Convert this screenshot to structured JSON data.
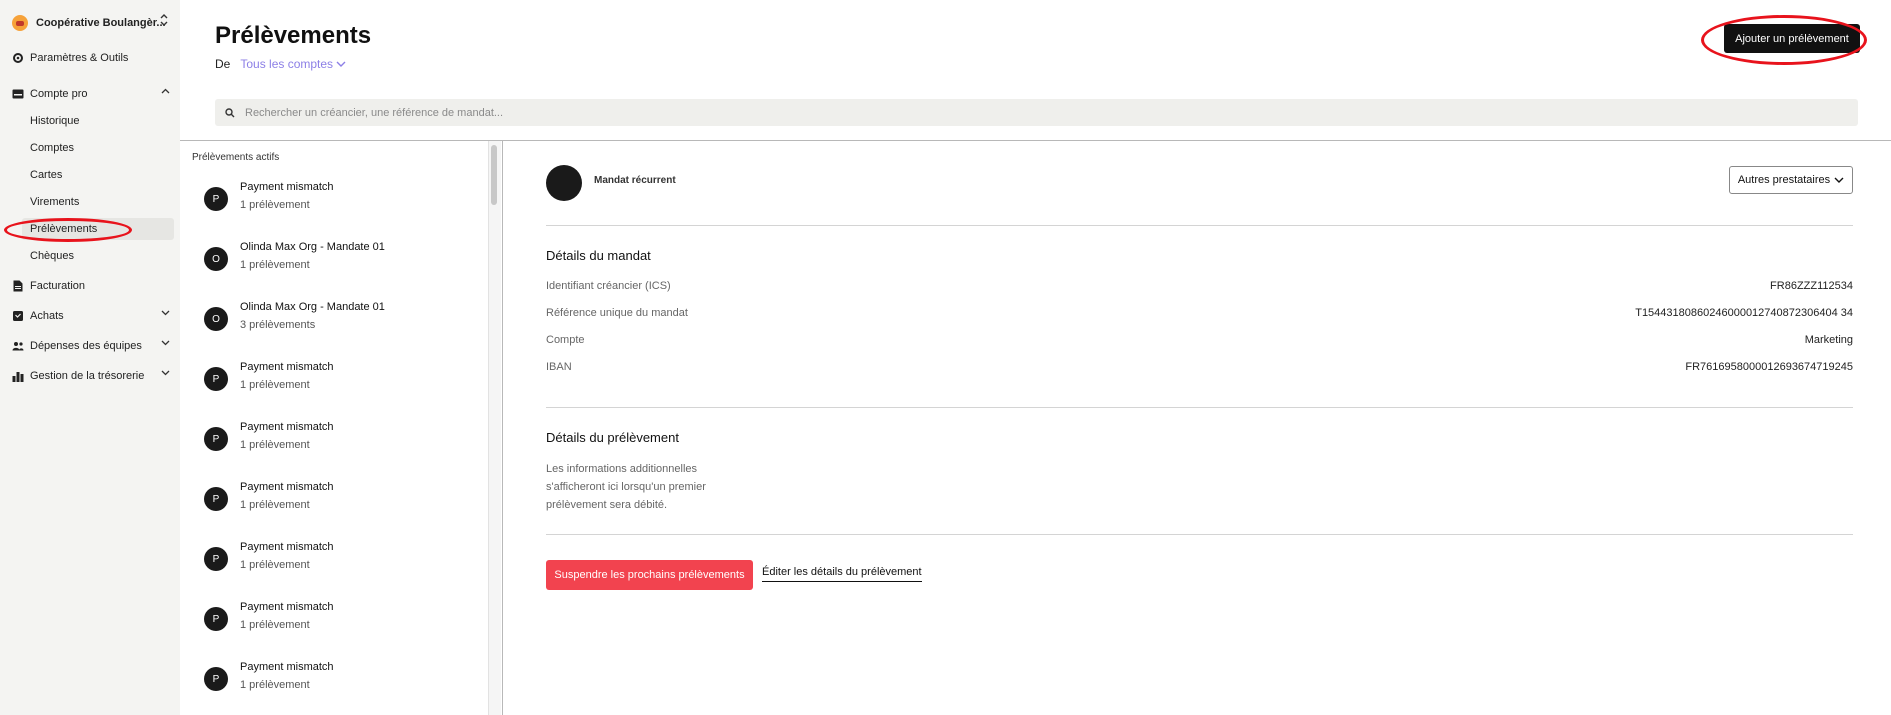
{
  "sidebar": {
    "org_name": "Coopérative Boulangèr...",
    "items": [
      {
        "label": "Paramètres & Outils",
        "icon": "gear-icon"
      },
      {
        "label": "Compte pro",
        "icon": "card-icon"
      },
      {
        "label": "Facturation",
        "icon": "document-icon"
      },
      {
        "label": "Achats",
        "icon": "cart-icon"
      },
      {
        "label": "Dépenses des équipes",
        "icon": "team-icon"
      },
      {
        "label": "Gestion de la trésorerie",
        "icon": "bar-chart-icon"
      }
    ],
    "sub_items": [
      "Historique",
      "Comptes",
      "Cartes",
      "Virements",
      "Prélèvements",
      "Chèques"
    ],
    "active_sub_item": "Prélèvements"
  },
  "header": {
    "title": "Prélèvements",
    "from_label": "De",
    "from_value": "Tous les comptes",
    "add_button": "Ajouter un prélèvement"
  },
  "search": {
    "placeholder": "Rechercher un créancier, une référence de mandat..."
  },
  "list": {
    "title": "Prélèvements actifs",
    "items": [
      {
        "initial": "P",
        "name": "Payment mismatch",
        "count": "1 prélèvement"
      },
      {
        "initial": "O",
        "name": "Olinda Max Org - Mandate 01",
        "count": "1 prélèvement"
      },
      {
        "initial": "O",
        "name": "Olinda Max Org - Mandate 01",
        "count": "3 prélèvements"
      },
      {
        "initial": "P",
        "name": "Payment mismatch",
        "count": "1 prélèvement"
      },
      {
        "initial": "P",
        "name": "Payment mismatch",
        "count": "1 prélèvement"
      },
      {
        "initial": "P",
        "name": "Payment mismatch",
        "count": "1 prélèvement"
      },
      {
        "initial": "P",
        "name": "Payment mismatch",
        "count": "1 prélèvement"
      },
      {
        "initial": "P",
        "name": "Payment mismatch",
        "count": "1 prélèvement"
      },
      {
        "initial": "P",
        "name": "Payment mismatch",
        "count": "1 prélèvement"
      }
    ]
  },
  "detail": {
    "mandate_type": "Mandat récurrent",
    "providers_button": "Autres prestataires",
    "mandate_section_title": "Détails du mandat",
    "fields": [
      {
        "label": "Identifiant créancier (ICS)",
        "value": "FR86ZZZ112534"
      },
      {
        "label": "Référence unique du mandat",
        "value": "T15443180860246000012740872306404 34"
      },
      {
        "label": "Compte",
        "value": "Marketing"
      },
      {
        "label": "IBAN",
        "value": "FR7616958000012693674719245"
      }
    ],
    "debit_section_title": "Détails du prélèvement",
    "debit_info": "Les informations additionnelles s'afficheront ici lorsqu'un premier prélèvement sera débité.",
    "suspend_button": "Suspendre les prochains prélèvements",
    "edit_link": "Éditer les détails du prélèvement"
  },
  "colors": {
    "accent_purple": "#8c7fe6",
    "danger_red": "#f2434f",
    "annotation_red": "#e8131c",
    "primary_black": "#111111"
  }
}
